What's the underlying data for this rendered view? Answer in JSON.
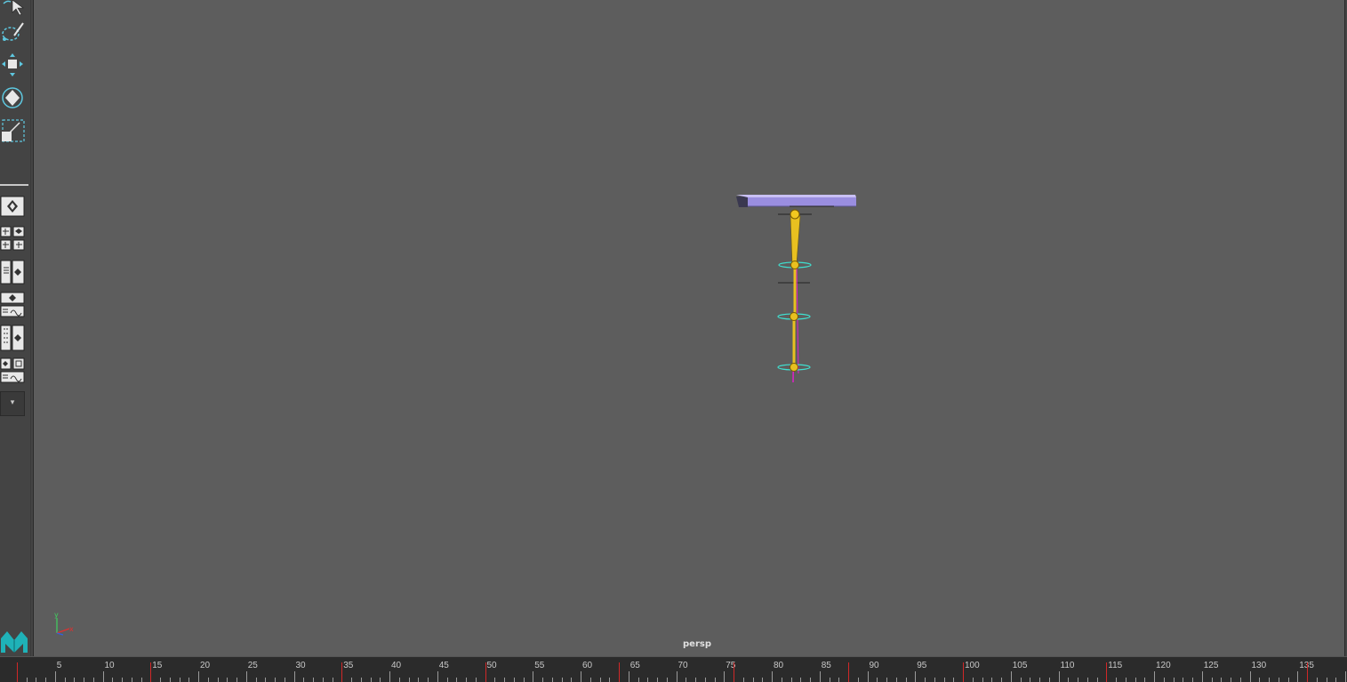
{
  "viewport": {
    "camera_name": "persp",
    "axis_y_label": "y",
    "axis_x_label": "x"
  },
  "toolbox": {
    "tools": [
      "select-tool-icon",
      "lasso-tool-icon",
      "move-tool-icon",
      "rotate-tool-icon",
      "scale-tool-icon"
    ],
    "layout_buttons": [
      "single-view-layout-icon",
      "four-view-layout-icon",
      "outliner-layout-icon",
      "graph-editor-layout-icon",
      "hypershade-layout-icon",
      "custom-layout-icon"
    ],
    "expand_glyph": "▾"
  },
  "timeline": {
    "labels": [
      "5",
      "10",
      "15",
      "20",
      "25",
      "30",
      "35",
      "40",
      "45",
      "50",
      "55",
      "60",
      "65",
      "70",
      "75",
      "80",
      "85",
      "90",
      "95",
      "100",
      "105",
      "110",
      "115",
      "120",
      "125",
      "130",
      "135"
    ],
    "key_frames": [
      1,
      15,
      35,
      50,
      64,
      76,
      88,
      100,
      115,
      136
    ],
    "colors": {
      "key": "#d02828",
      "tick": "#9a9a9a"
    }
  },
  "colors": {
    "viewport_bg": "#5d5d5d",
    "joint": "#e8c020",
    "bone_magenta": "#e020c8",
    "ring_cyan": "#40e0d0",
    "platform": "#9a8ee0",
    "tool_accent": "#5ec8e0"
  }
}
